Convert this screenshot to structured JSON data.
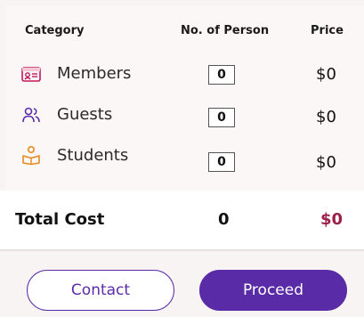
{
  "header": {
    "category": "Category",
    "persons": "No. of Person",
    "price": "Price"
  },
  "rows": [
    {
      "label": "Members",
      "icon": "id-card-icon",
      "icon_color": "#c2185b",
      "count": "0",
      "price": "$0"
    },
    {
      "label": "Guests",
      "icon": "users-icon",
      "icon_color": "#5b2ca8",
      "count": "0",
      "price": "$0"
    },
    {
      "label": "Students",
      "icon": "student-reading-icon",
      "icon_color": "#e58a1f",
      "count": "0",
      "price": "$0"
    }
  ],
  "total": {
    "label": "Total Cost",
    "count": "0",
    "price": "$0",
    "price_color": "#9c1f4a"
  },
  "buttons": {
    "contact": "Contact",
    "proceed": "Proceed",
    "accent": "#5a2ba6"
  }
}
